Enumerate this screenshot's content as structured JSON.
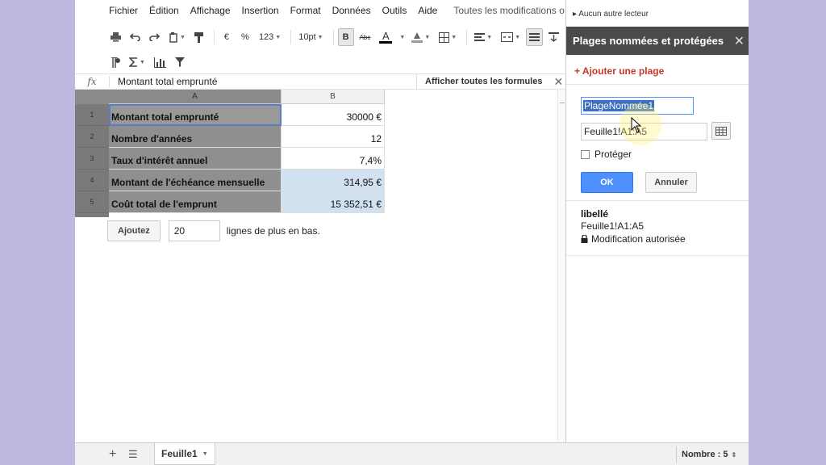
{
  "menu": {
    "items": [
      "Fichier",
      "Édition",
      "Affichage",
      "Insertion",
      "Format",
      "Données",
      "Outils",
      "Aide"
    ],
    "status": "Toutes les modifications o"
  },
  "toolbar": {
    "row1": [
      {
        "name": "print-icon",
        "glyph": "⎙"
      },
      {
        "name": "undo-icon",
        "glyph": "↶"
      },
      {
        "name": "redo-icon",
        "glyph": "↷"
      },
      {
        "name": "paint-bucket-icon",
        "glyph": "⛀"
      },
      {
        "name": "paint-format-icon",
        "glyph": "🖌"
      }
    ],
    "currency": "€",
    "percent": "%",
    "number_format": "123",
    "font_size": "10pt",
    "bold": "B",
    "strike": "Abc",
    "text_color": "A"
  },
  "formula": {
    "fx": "fx",
    "content": "Montant total emprunté",
    "show_all": "Afficher toutes les formules",
    "close": "✕"
  },
  "grid": {
    "col_headers": [
      "A",
      "B"
    ],
    "rows": [
      {
        "num": "1",
        "label": "Montant total emprunté",
        "value": "30000 €"
      },
      {
        "num": "2",
        "label": "Nombre d'années",
        "value": "12"
      },
      {
        "num": "3",
        "label": "Taux d'intérêt annuel",
        "value": "7,4%"
      },
      {
        "num": "4",
        "label": "Montant de l'échéance mensuelle",
        "value": "314,95 €"
      },
      {
        "num": "5",
        "label": "Coût total de l'emprunt",
        "value": "15 352,51 €"
      }
    ],
    "add_button": "Ajoutez",
    "add_count": "20",
    "add_text": "lignes de plus en bas."
  },
  "bottom": {
    "sheet_name": "Feuille1",
    "count": "Nombre : 5"
  },
  "panel": {
    "no_reader": "Aucun autre lecteur",
    "title": "Plages nommées et protégées",
    "add_range": "+ Ajouter une plage",
    "name_value": "PlageNommée1",
    "range_value": "Feuille1!A1:A5",
    "protect_label": "Protéger",
    "ok": "OK",
    "cancel": "Annuler",
    "existing": {
      "name": "libellé",
      "range": "Feuille1!A1:A5",
      "permission": "Modification autorisée"
    }
  }
}
